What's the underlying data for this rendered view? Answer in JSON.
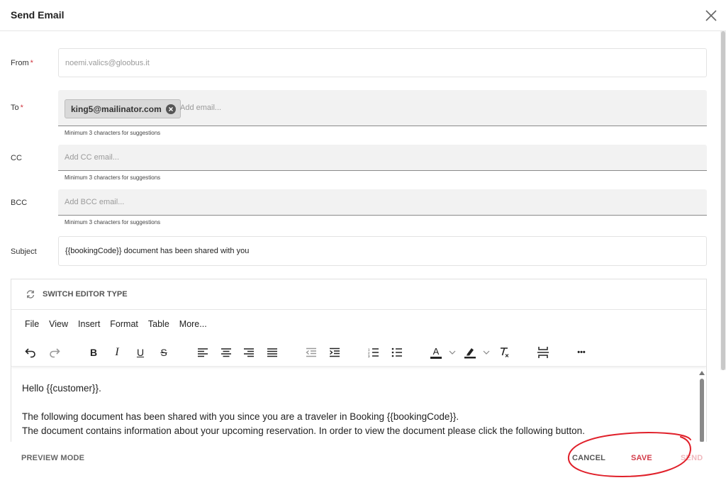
{
  "dialog": {
    "title": "Send Email"
  },
  "form": {
    "from": {
      "label": "From",
      "required_mark": "*",
      "value": "noemi.valics@gloobus.it"
    },
    "to": {
      "label": "To",
      "required_mark": "*",
      "chip": "king5@mailinator.com",
      "placeholder": "Add email...",
      "hint": "Minimum 3 characters for suggestions"
    },
    "cc": {
      "label": "CC",
      "placeholder": "Add CC email...",
      "hint": "Minimum 3 characters for suggestions"
    },
    "bcc": {
      "label": "BCC",
      "placeholder": "Add BCC email...",
      "hint": "Minimum 3 characters for suggestions"
    },
    "subject": {
      "label": "Subject",
      "value": "{{bookingCode}} document has been shared with you"
    }
  },
  "editor": {
    "switch_label": "SWITCH EDITOR TYPE",
    "menu": [
      "File",
      "View",
      "Insert",
      "Format",
      "Table",
      "More..."
    ],
    "toolbar": {
      "bold": "B",
      "italic": "I",
      "underline": "U",
      "strike": "S",
      "text_color": "A",
      "more": "•••"
    },
    "body": [
      "Hello {{customer}}.",
      "",
      "The following document has been shared with you since you are a traveler in Booking {{bookingCode}}.",
      "The document contains information about your upcoming reservation. In order to view the document please click the following button."
    ]
  },
  "footer": {
    "preview": "PREVIEW MODE",
    "cancel": "CANCEL",
    "save": "SAVE",
    "send": "SEND"
  },
  "colors": {
    "accent": "#d33b49",
    "annotation": "#e0202a",
    "send_disabled": "#f0b8bd"
  }
}
